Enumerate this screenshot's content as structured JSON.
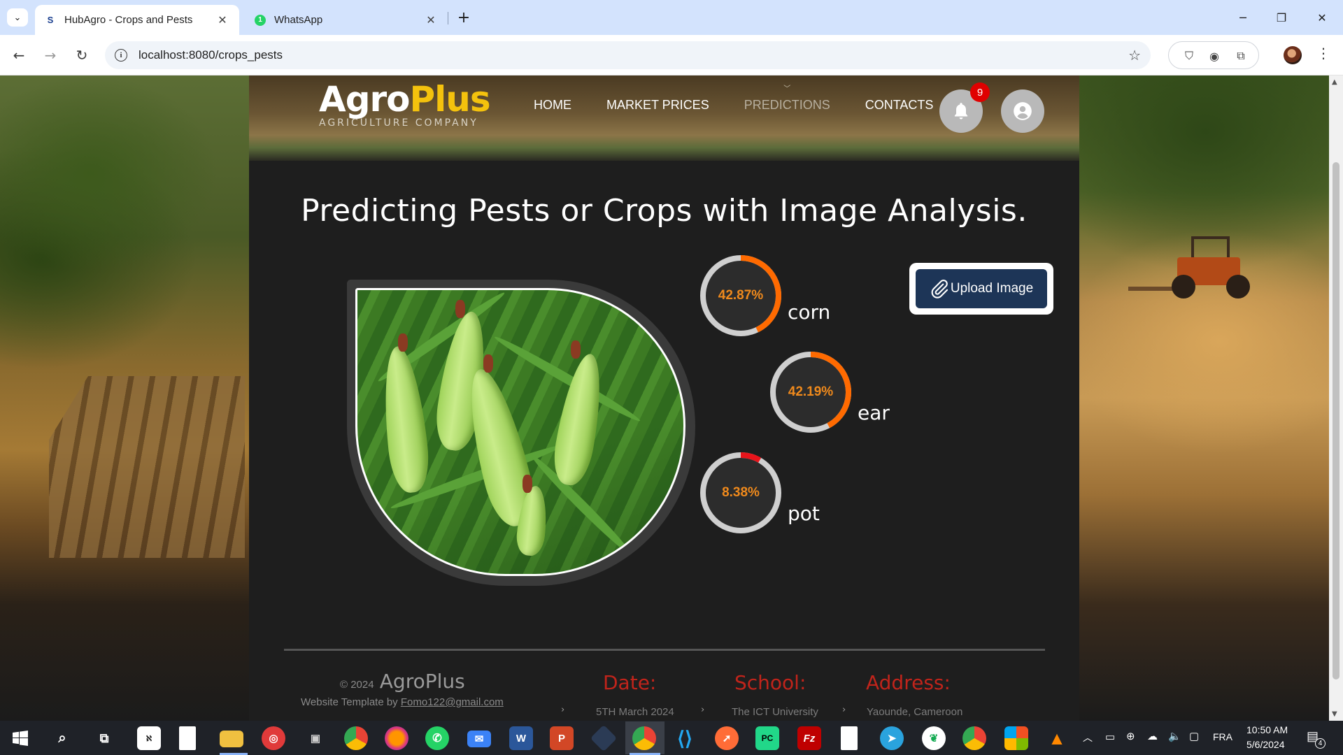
{
  "browser": {
    "tabs": [
      {
        "title": "HubAgro - Crops and Pests",
        "favicon": "S",
        "active": true
      },
      {
        "title": "WhatsApp",
        "favicon": "1",
        "active": false
      }
    ],
    "url": "localhost:8080/crops_pests"
  },
  "site": {
    "logo": {
      "part1": "Agro",
      "part2": "Plus",
      "tagline": "AGRICULTURE COMPANY"
    },
    "nav": [
      "HOME",
      "MARKET PRICES",
      "PREDICTIONS",
      "CONTACTS"
    ],
    "notification_count": "9",
    "headline": "Predicting Pests or Crops with Image Analysis.",
    "upload_label": "Upload Image",
    "predictions": [
      {
        "label": "corn",
        "value_text": "42.87%",
        "value": 42.87,
        "color": "#ff6a00"
      },
      {
        "label": "ear",
        "value_text": "42.19%",
        "value": 42.19,
        "color": "#ff6a00"
      },
      {
        "label": "pot",
        "value_text": "8.38%",
        "value": 8.38,
        "color": "#e8141b"
      }
    ],
    "footer": {
      "copyright": "© 2024",
      "brand": "AgroPlus",
      "template_prefix": "Website Template by",
      "template_email": "Fomo122@gmail.com",
      "columns": [
        {
          "heading": "Date:",
          "value": "5TH March 2024"
        },
        {
          "heading": "School:",
          "value": "The ICT University"
        },
        {
          "heading": "Address:",
          "value": "Yaounde, Cameroon"
        }
      ]
    }
  },
  "taskbar": {
    "language": "FRA",
    "time": "10:50 AM",
    "date": "5/6/2024",
    "notifications": "4"
  },
  "colors": {
    "accent_orange": "#f08a1c",
    "header_blue": "#1d3557",
    "footer_red": "#c0241b"
  }
}
